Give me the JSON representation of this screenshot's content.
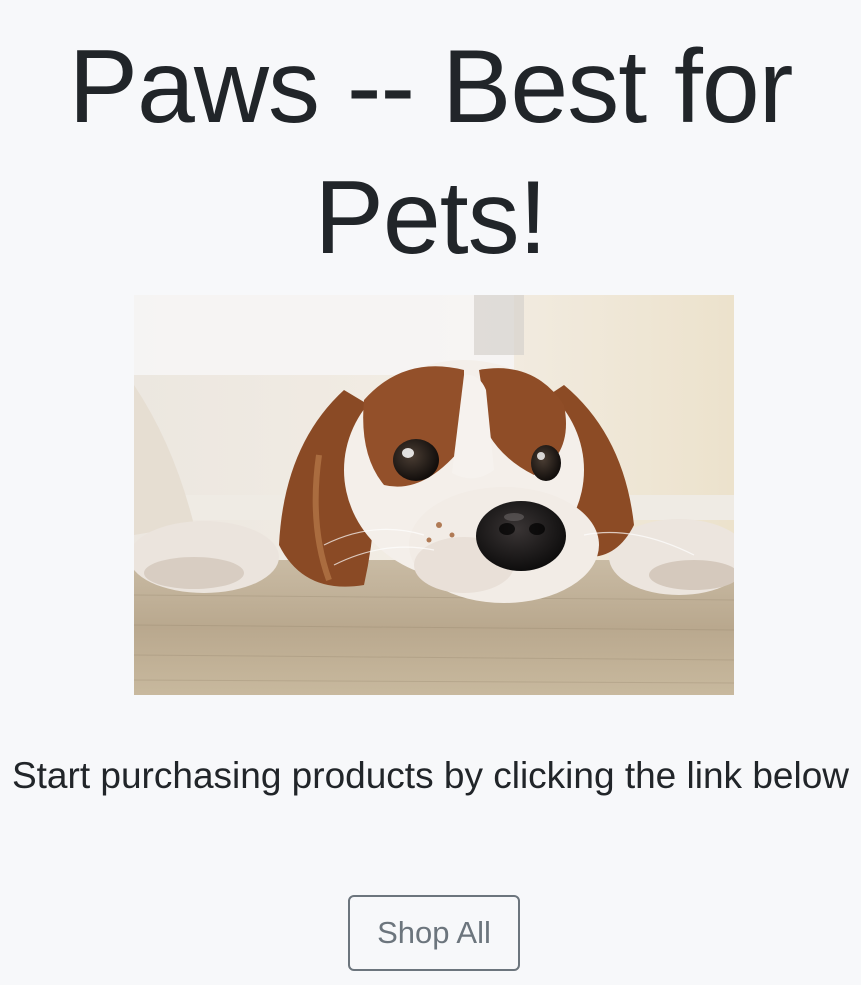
{
  "hero": {
    "title": "Paws -- Best for Pets!",
    "image_alt": "puppy"
  },
  "main": {
    "intro": "Start purchasing products by clicking the link below",
    "shop_button_label": "Shop All"
  },
  "colors": {
    "background": "#f7f8fa",
    "text": "#212529",
    "button_outline": "#6c757d"
  }
}
